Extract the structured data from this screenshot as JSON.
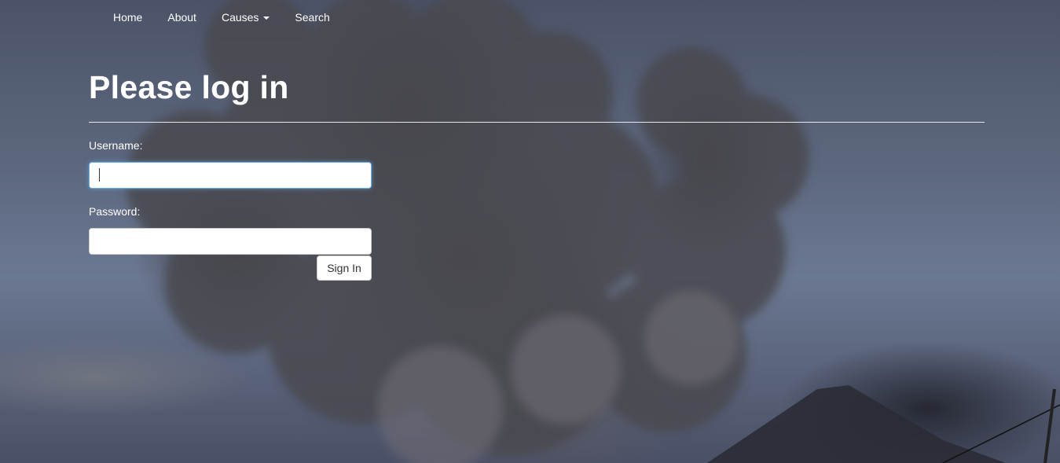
{
  "nav": {
    "items": [
      {
        "label": "Home"
      },
      {
        "label": "About"
      },
      {
        "label": "Causes"
      },
      {
        "label": "Search"
      }
    ]
  },
  "login": {
    "title": "Please log in",
    "username_label": "Username:",
    "username_value": "",
    "password_label": "Password:",
    "password_value": "",
    "submit_label": "Sign In"
  },
  "background": {
    "image": "volcano-eruption-ash-cloud",
    "sky_color": "#5c677e",
    "ash_color": "#46444a"
  }
}
